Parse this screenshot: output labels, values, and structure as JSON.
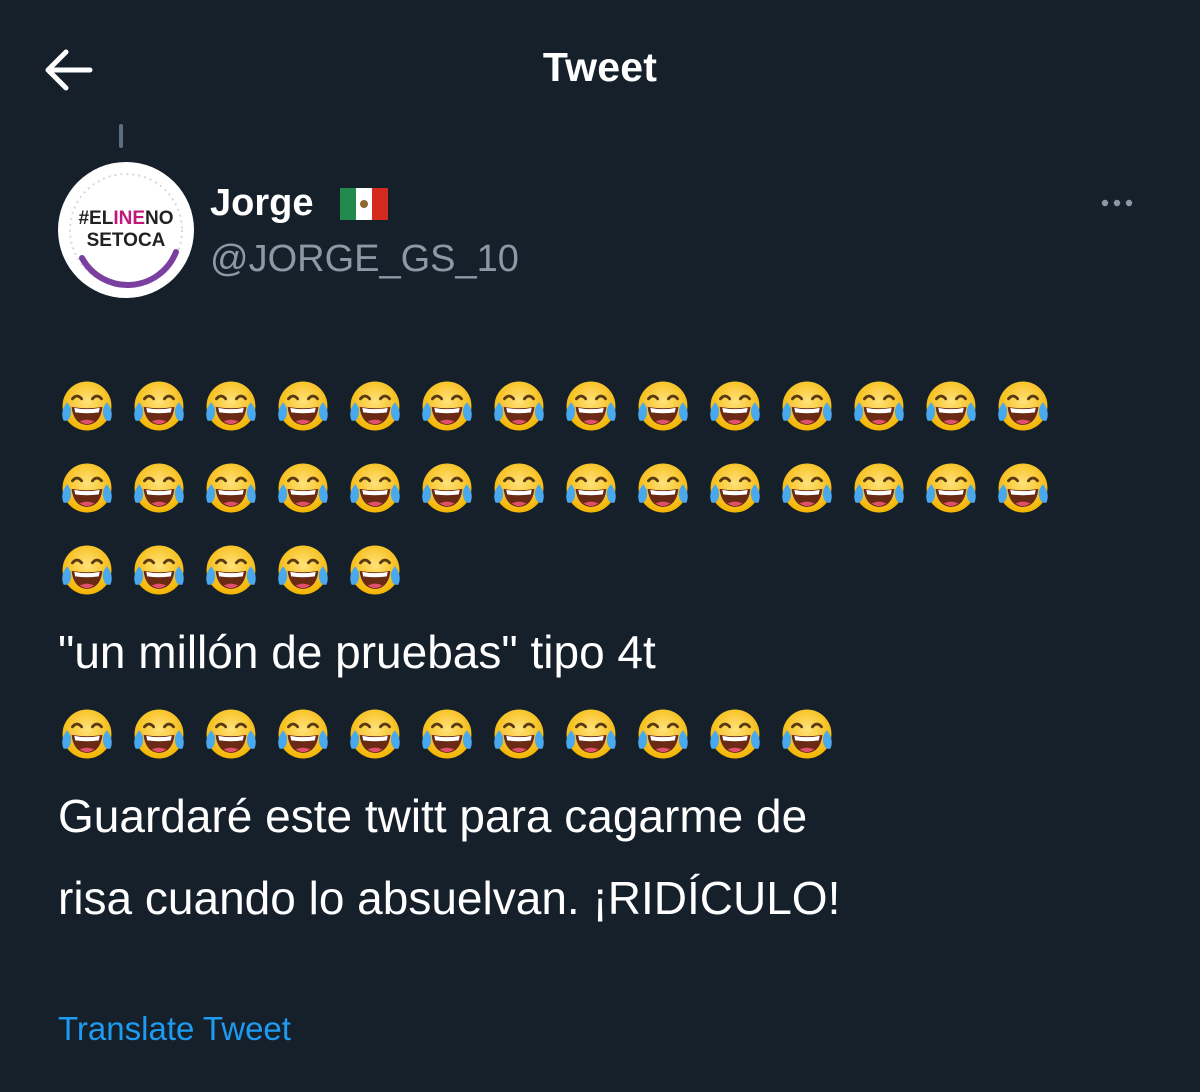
{
  "header": {
    "back_icon": "arrow-left-icon",
    "title": "Tweet"
  },
  "author": {
    "name": "Jorge",
    "flag_icon": "mexico-flag-icon",
    "handle": "@JORGE_GS_10",
    "avatar": {
      "line1": "#ELINENO",
      "line2": "SETOCA",
      "accent_color": "#c0187a",
      "arc_color": "#7b3fa0"
    }
  },
  "more_icon": "more-horizontal-icon",
  "tweet": {
    "emoji_icon": "face-with-tears-of-joy-emoji",
    "emoji_counts": [
      14,
      14,
      5
    ],
    "line1": "\"un millón de pruebas\" tipo 4t",
    "emoji_counts_2": [
      11
    ],
    "line2": "Guardaré este twitt para cagarme de",
    "line3": "risa cuando lo absuelvan. ¡RIDÍCULO!"
  },
  "translate_label": "Translate Tweet",
  "colors": {
    "background": "#15202b",
    "secondary_text": "#8b98a5",
    "link": "#1d9bf0"
  }
}
